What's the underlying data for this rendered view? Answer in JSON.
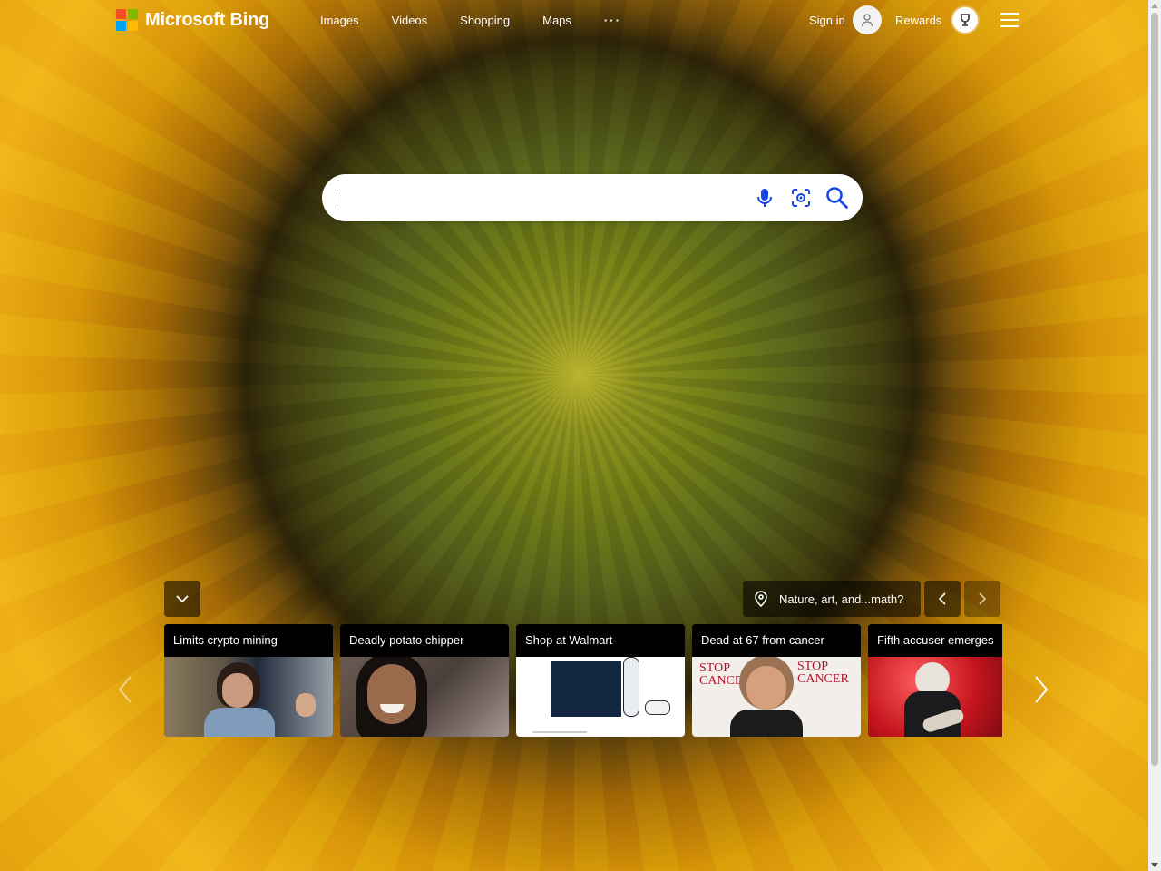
{
  "header": {
    "logo_text": "Microsoft Bing",
    "nav": [
      "Images",
      "Videos",
      "Shopping",
      "Maps",
      "···"
    ],
    "signin_label": "Sign in",
    "rewards_label": "Rewards"
  },
  "colors": {
    "ms_red": "#f25022",
    "ms_green": "#7fba00",
    "ms_blue": "#00a4ef",
    "ms_yellow": "#ffb900",
    "search_icon_blue": "#174ae4",
    "overlay_dark": "rgba(0,0,0,0.55)"
  },
  "search": {
    "value": "",
    "icons": [
      "microphone-icon",
      "visual-search-icon",
      "search-icon"
    ]
  },
  "image_info": {
    "label": "Nature, art, and...math?"
  },
  "news_cards": [
    {
      "title": "Limits crypto mining"
    },
    {
      "title": "Deadly potato chipper"
    },
    {
      "title": "Shop at Walmart"
    },
    {
      "title": "Dead at 67 from cancer"
    },
    {
      "title": "Fifth accuser emerges"
    }
  ]
}
